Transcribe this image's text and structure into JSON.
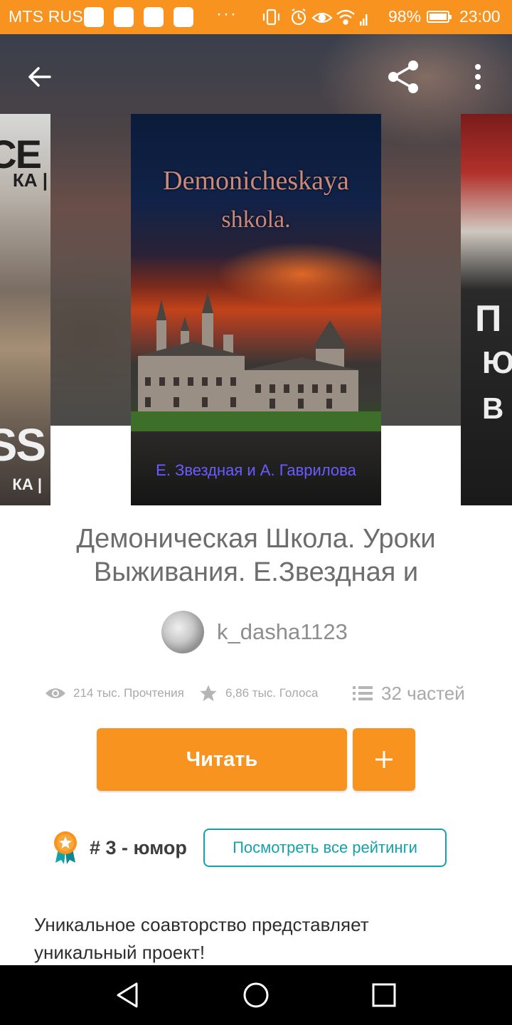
{
  "status_bar": {
    "carrier": "MTS RUS",
    "dots": "···",
    "battery_percent": "98%",
    "time": "23:00"
  },
  "toolbar": {
    "back_icon": "arrow-left-icon",
    "share_icon": "share-icon",
    "menu_icon": "more-vertical-icon"
  },
  "covers": {
    "left": {
      "line1": "RCE",
      "line2": "КА |",
      "line3": "ESS",
      "line4": "КА |"
    },
    "main": {
      "title_line1": "Demonicheskaya",
      "title_line2": "shkola.",
      "authors": "Е. Звездная и А. Гаврилова"
    },
    "right": {
      "line1": "П",
      "line2": "Ю",
      "line3": "В"
    }
  },
  "book": {
    "title": "Демоническая Школа. Уроки Выживания. Е.Звездная и",
    "author": "k_dasha1123"
  },
  "stats": {
    "reads": "214 тыс. Прочтения",
    "votes": "6,86 тыс. Голоса",
    "parts": "32 частей"
  },
  "actions": {
    "read_label": "Читать",
    "add_label": "+"
  },
  "ranking": {
    "text": "# 3 - юмор",
    "all_ratings_label": "Посмотреть все рейтинги"
  },
  "description": "Уникальное соавторство представляет уникальный проект!",
  "colors": {
    "accent": "#f7931e",
    "teal": "#11a3a9"
  }
}
